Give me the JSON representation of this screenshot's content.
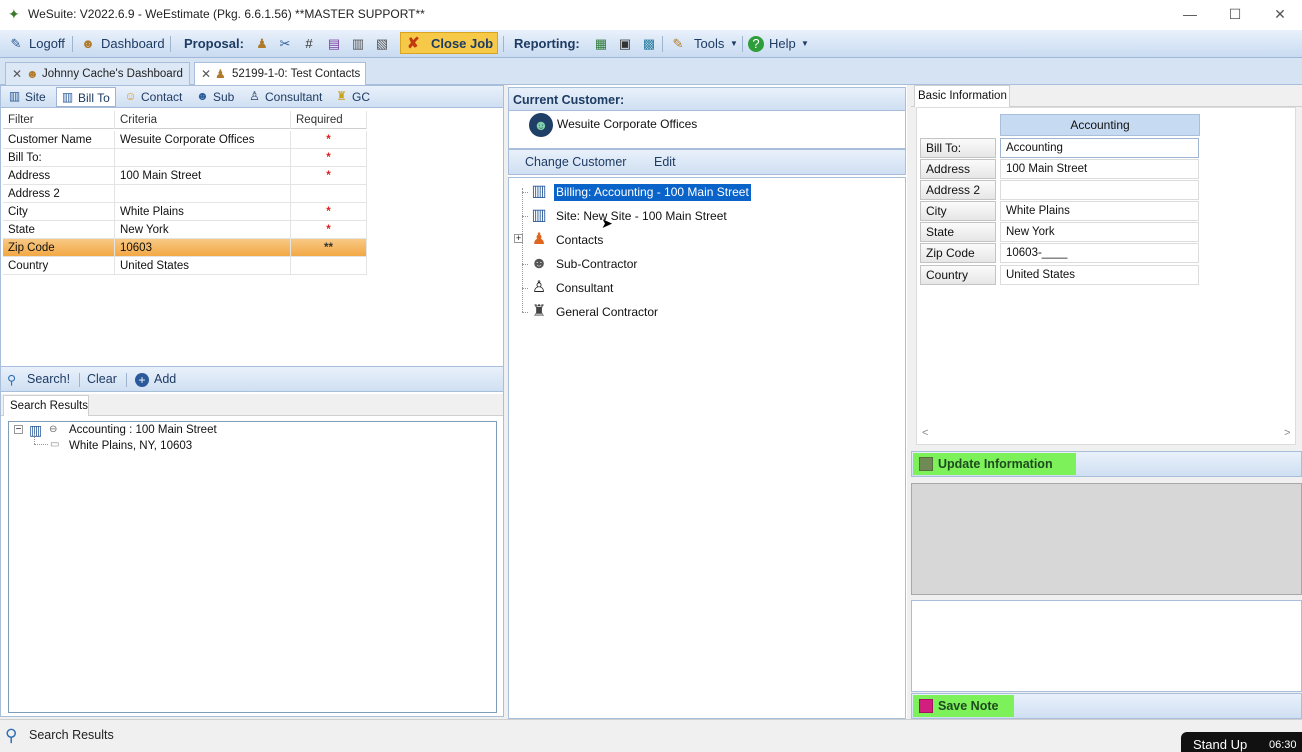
{
  "window": {
    "title": "WeSuite: V2022.6.9 - WeEstimate (Pkg. 6.6.1.56) **MASTER SUPPORT**",
    "controls": {
      "minimize": "—",
      "maximize": "☐",
      "close": "✕"
    }
  },
  "menubar": {
    "logoff": "Logoff",
    "dashboard": "Dashboard",
    "proposal": "Proposal:",
    "close_job": "Close Job",
    "reporting": "Reporting:",
    "tools": "Tools",
    "help": "Help"
  },
  "doc_tabs": [
    {
      "label": "Johnny Cache's Dashboard",
      "active": false
    },
    {
      "label": "52199-1-0: Test Contacts",
      "active": true
    }
  ],
  "sub_tabs": [
    {
      "label": "Site",
      "icon": "building-icon"
    },
    {
      "label": "Bill To",
      "icon": "building-icon",
      "active": true
    },
    {
      "label": "Contact",
      "icon": "person-icon"
    },
    {
      "label": "Sub",
      "icon": "worker-icon"
    },
    {
      "label": "Consultant",
      "icon": "consultant-icon"
    },
    {
      "label": "GC",
      "icon": "gc-icon"
    }
  ],
  "filter_table": {
    "headers": [
      "Filter",
      "Criteria",
      "Required"
    ],
    "rows": [
      {
        "filter": "Customer Name",
        "criteria": "Wesuite Corporate Offices",
        "required": "*"
      },
      {
        "filter": "Bill To:",
        "criteria": "",
        "required": "*"
      },
      {
        "filter": "Address",
        "criteria": "100 Main Street",
        "required": "*"
      },
      {
        "filter": "Address 2",
        "criteria": "",
        "required": ""
      },
      {
        "filter": "City",
        "criteria": "White Plains",
        "required": "*"
      },
      {
        "filter": "State",
        "criteria": "New York",
        "required": "*"
      },
      {
        "filter": "Zip Code",
        "criteria": "10603",
        "required": "**",
        "selected": true
      },
      {
        "filter": "Country",
        "criteria": "United States",
        "required": ""
      }
    ]
  },
  "search_bar": {
    "search": "Search!",
    "clear": "Clear",
    "add": "Add"
  },
  "search_results": {
    "tab": "Search Results",
    "items": [
      {
        "label": "Accounting : 100 Main Street",
        "child": "White Plains, NY, 10603"
      }
    ]
  },
  "current_customer": {
    "header": "Current Customer:",
    "name": "Wesuite Corporate Offices",
    "actions": {
      "change": "Change Customer",
      "edit": "Edit"
    },
    "tree": [
      {
        "label": "Billing: Accounting -  100 Main Street",
        "icon": "billing-building-icon",
        "selected": true
      },
      {
        "label": "Site: New Site -  100 Main Street",
        "icon": "building-icon"
      },
      {
        "label": "Contacts",
        "icon": "contacts-icon",
        "expandable": true
      },
      {
        "label": "Sub-Contractor",
        "icon": "worker-icon"
      },
      {
        "label": "Consultant",
        "icon": "consultant-icon"
      },
      {
        "label": "General Contractor",
        "icon": "gc-icon"
      }
    ]
  },
  "basic_info": {
    "tab": "Basic Information",
    "header": "Accounting",
    "fields": [
      {
        "label": "Bill To:",
        "value": "Accounting"
      },
      {
        "label": "Address",
        "value": "100 Main Street"
      },
      {
        "label": "Address 2",
        "value": ""
      },
      {
        "label": "City",
        "value": "White Plains"
      },
      {
        "label": "State",
        "value": "New York"
      },
      {
        "label": "Zip Code",
        "value": "10603-____"
      },
      {
        "label": "Country",
        "value": "United States"
      }
    ],
    "update_button": "Update Information",
    "save_button": "Save Note"
  },
  "statusbar": {
    "label": "Search Results",
    "overlay_title": "Stand Up",
    "overlay_time": "06:30"
  },
  "colors": {
    "accent_blue": "#0a63c9",
    "highlight_orange": "#f2a844",
    "button_green": "#7cf15a",
    "close_job_yellow": "#f7c948"
  }
}
